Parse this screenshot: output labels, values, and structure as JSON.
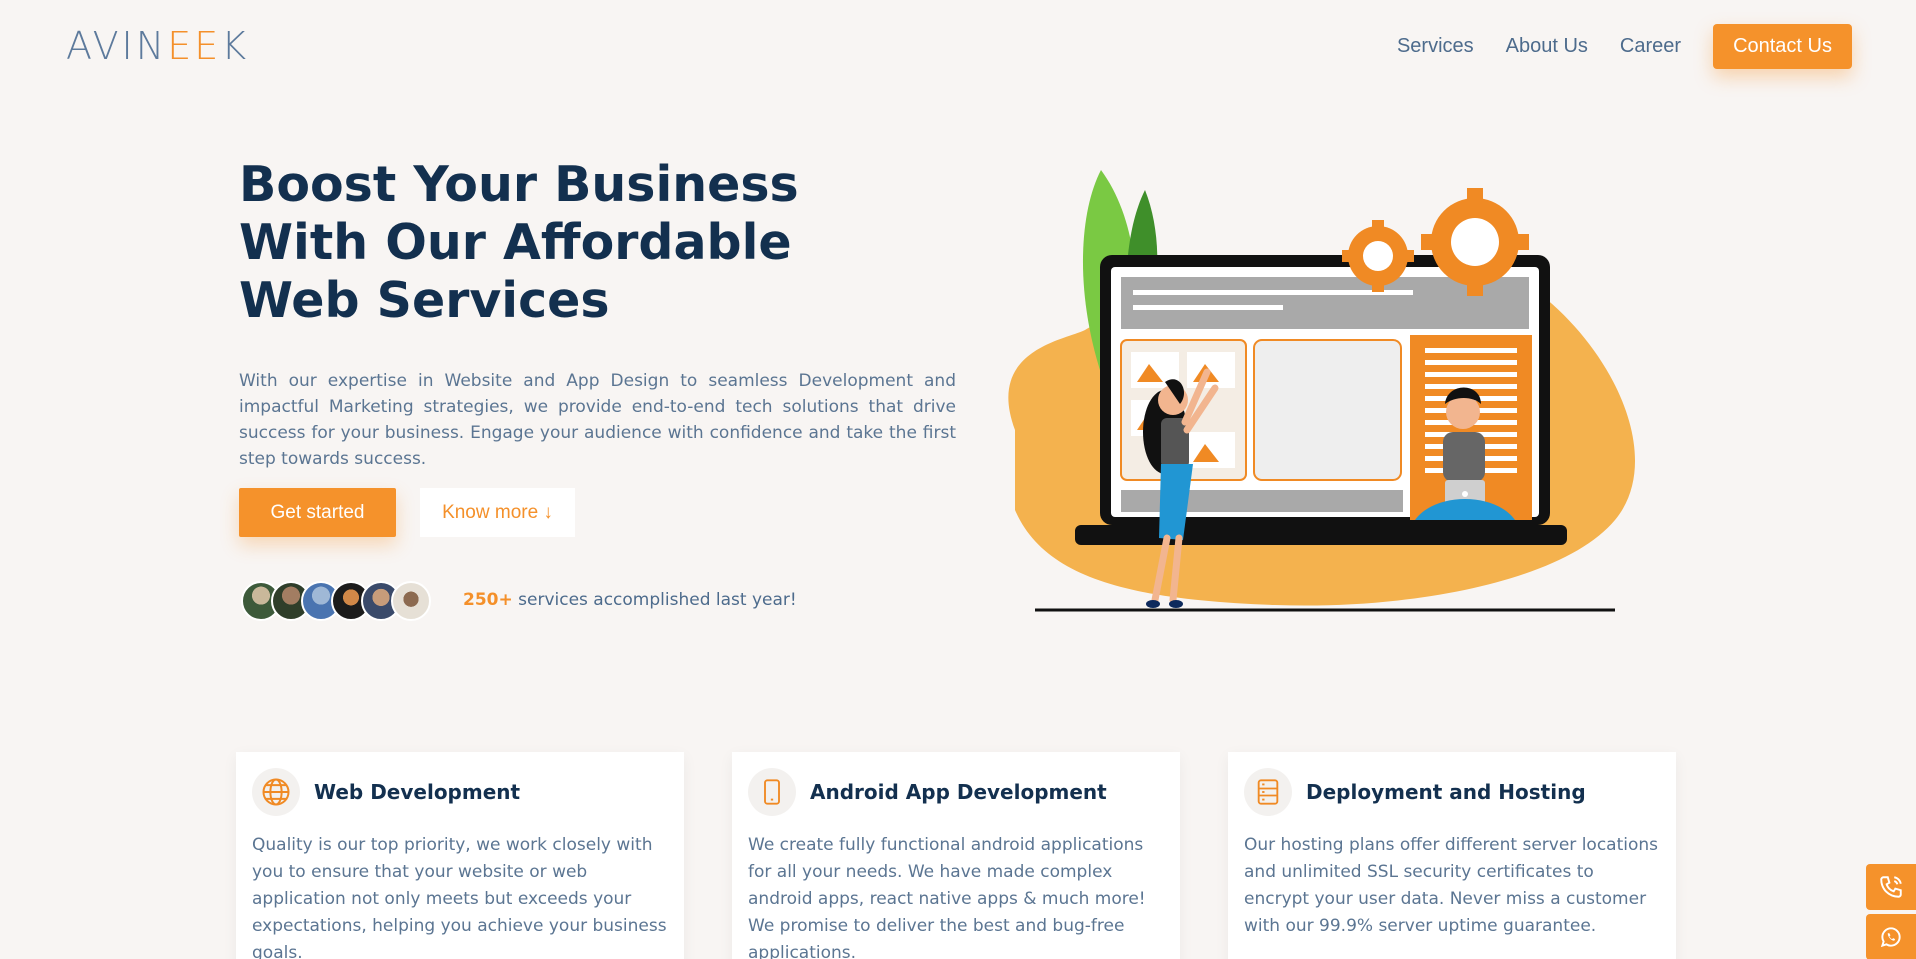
{
  "header": {
    "logo": {
      "prefix": "AVIN",
      "accent": "EE",
      "suffix": "K"
    },
    "nav": [
      "Services",
      "About Us",
      "Career"
    ],
    "contact_label": "Contact Us"
  },
  "hero": {
    "title_lines": [
      "Boost Your Business",
      "With Our Affordable",
      "Web Services"
    ],
    "description": "With our expertise in Website and App Design to seamless Development and impactful Marketing strategies, we provide end-to-end tech solutions that drive success for your business. Engage your audience with confidence and take the first step towards success.",
    "primary_cta": "Get started",
    "secondary_cta": "Know more ↓",
    "proof_count": "250+",
    "proof_text": " services accomplished last year!"
  },
  "cards": [
    {
      "title": "Web Development",
      "icon": "globe-icon",
      "text": "Quality is our top priority, we work closely with you to ensure that your website or web application not only meets but exceeds your expectations, helping you achieve your business goals."
    },
    {
      "title": "Android App Development",
      "icon": "mobile-icon",
      "text": "We create fully functional android applications for all your needs. We have made complex android apps, react native apps & much more! We promise to deliver the best and bug-free applications."
    },
    {
      "title": "Deployment and Hosting",
      "icon": "server-icon",
      "text": "Our hosting plans offer different server locations and unlimited SSL security certificates to encrypt your user data. Never miss a customer with our 99.9% server uptime guarantee."
    }
  ],
  "colors": {
    "accent": "#f5922b",
    "heading": "#13304f",
    "body_text": "#5b7592",
    "background": "#f8f5f3"
  },
  "floating": {
    "call_icon": "phone-icon",
    "whatsapp_icon": "whatsapp-icon"
  }
}
